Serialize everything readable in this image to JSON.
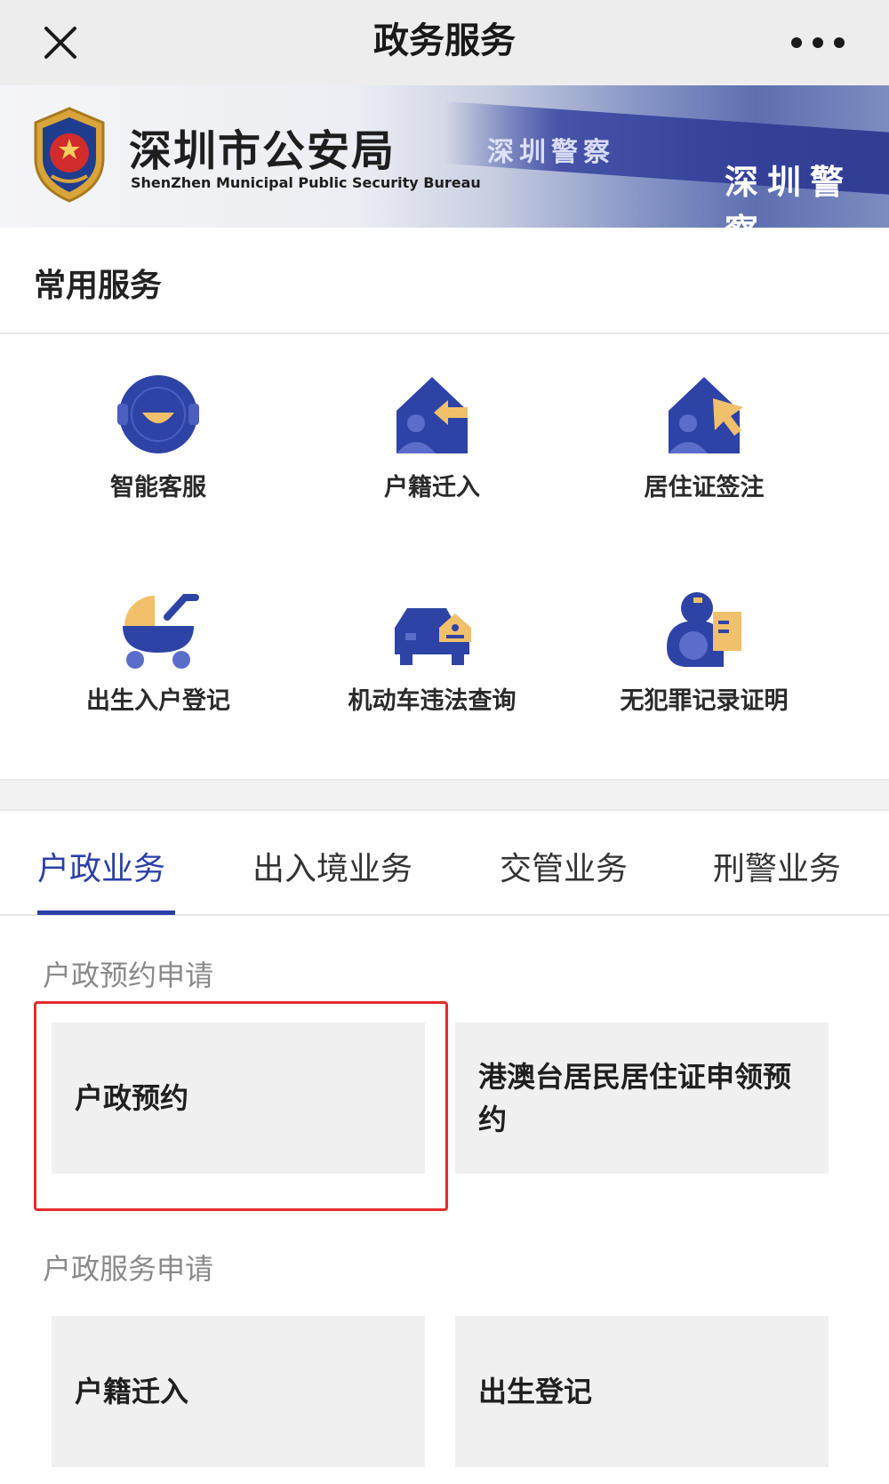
{
  "topbar": {
    "title": "政务服务"
  },
  "banner": {
    "org_name_cn": "深圳市公安局",
    "org_name_en": "ShenZhen Municipal Public Security Bureau",
    "stripe_text_left": "深圳警察",
    "stripe_text_right": "深圳警察"
  },
  "common_services": {
    "heading": "常用服务",
    "items": [
      {
        "label": "智能客服",
        "icon": "customer-service-icon"
      },
      {
        "label": "户籍迁入",
        "icon": "house-arrow-icon"
      },
      {
        "label": "居住证签注",
        "icon": "house-cursor-icon"
      },
      {
        "label": "出生入户登记",
        "icon": "stroller-icon"
      },
      {
        "label": "机动车违法查询",
        "icon": "car-house-icon"
      },
      {
        "label": "无犯罪记录证明",
        "icon": "police-document-icon"
      }
    ]
  },
  "tabs": [
    {
      "label": "户政业务",
      "active": true
    },
    {
      "label": "出入境业务",
      "active": false
    },
    {
      "label": "交管业务",
      "active": false
    },
    {
      "label": "刑警业务",
      "active": false
    }
  ],
  "groups": [
    {
      "label": "户政预约申请",
      "cards": [
        "户政预约",
        "港澳台居民居住证申领预约"
      ]
    },
    {
      "label": "户政服务申请",
      "cards": [
        "户籍迁入",
        "出生登记"
      ]
    }
  ],
  "colors": {
    "primary_blue": "#2b3fa8",
    "icon_blue": "#2e43a6",
    "icon_gold": "#f1c06a",
    "highlight_red": "#e42c2c"
  }
}
